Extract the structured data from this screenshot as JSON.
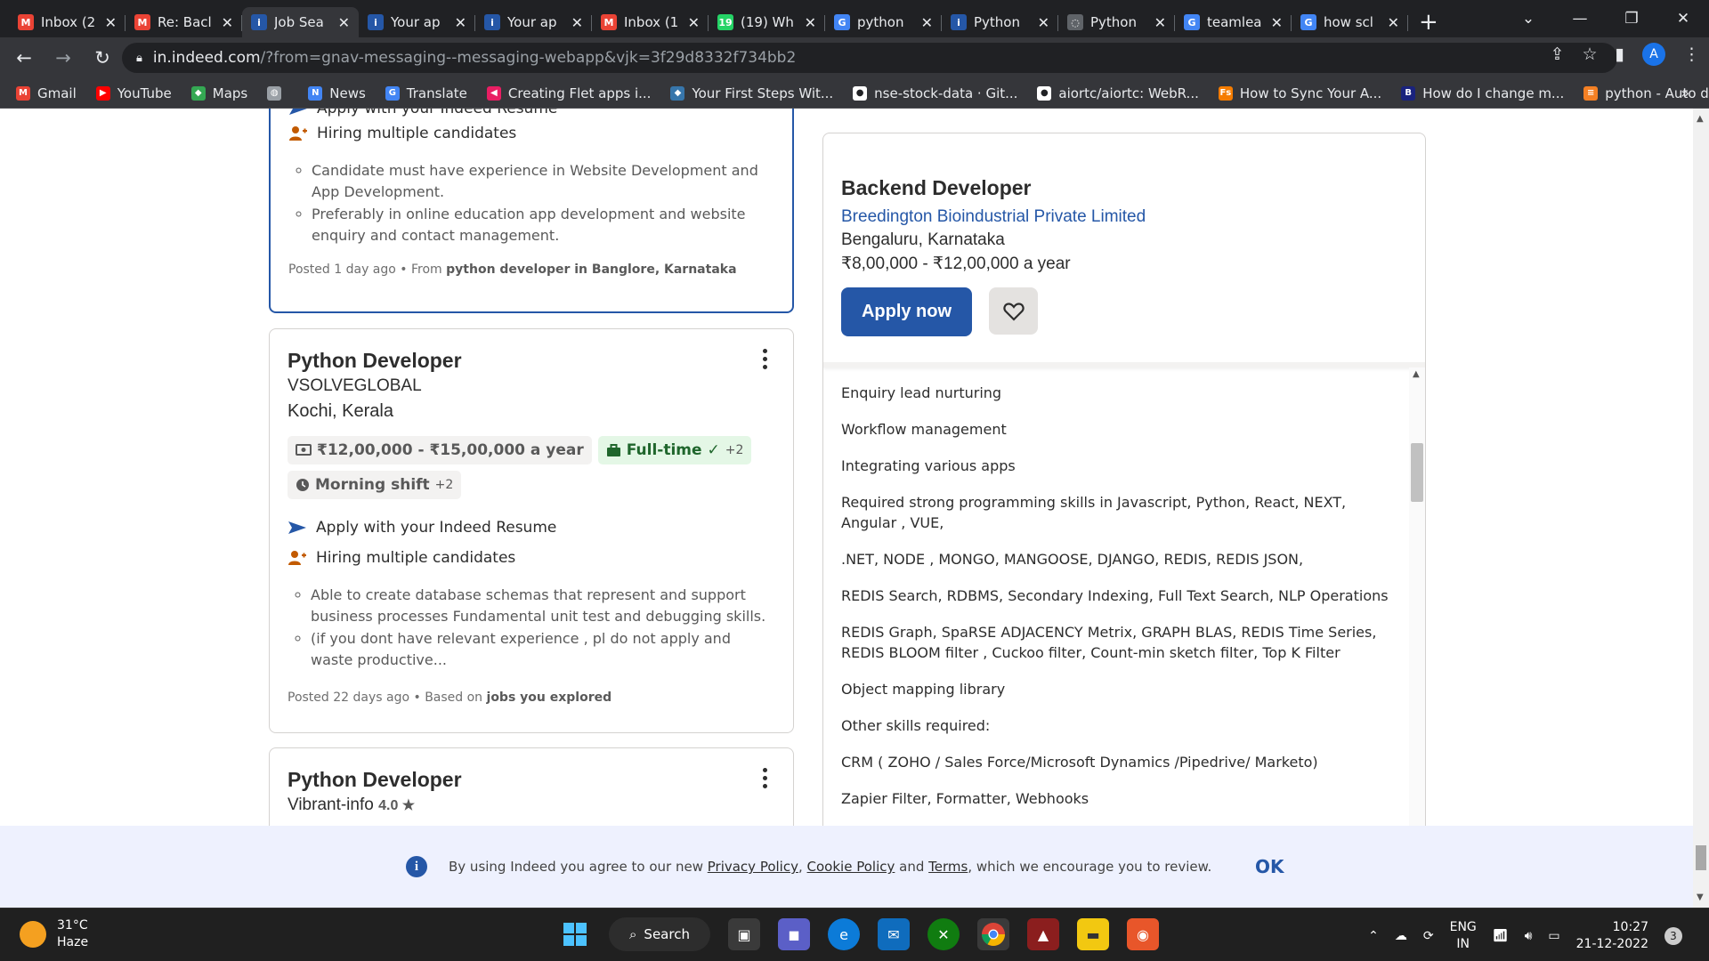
{
  "browser": {
    "tabs": [
      {
        "label": "Inbox (2",
        "icon": "gmail-icon",
        "color": "#ea4335",
        "glyph": "M"
      },
      {
        "label": "Re: Bacl",
        "icon": "gmail-icon",
        "color": "#ea4335",
        "glyph": "M"
      },
      {
        "label": "Job Sea",
        "icon": "indeed-icon",
        "color": "#2557a7",
        "glyph": "i",
        "active": true
      },
      {
        "label": "Your ap",
        "icon": "indeed-icon",
        "color": "#2557a7",
        "glyph": "i"
      },
      {
        "label": "Your ap",
        "icon": "indeed-icon",
        "color": "#2557a7",
        "glyph": "i"
      },
      {
        "label": "Inbox (1",
        "icon": "gmail-icon",
        "color": "#ea4335",
        "glyph": "M"
      },
      {
        "label": "(19) Wh",
        "icon": "whatsapp-icon",
        "color": "#25d366",
        "glyph": "19"
      },
      {
        "label": "python",
        "icon": "google-icon",
        "color": "#4285f4",
        "glyph": "G"
      },
      {
        "label": "Python",
        "icon": "indeed-icon",
        "color": "#2557a7",
        "glyph": "i"
      },
      {
        "label": "Python",
        "icon": "loading-icon",
        "color": "#5f6368",
        "glyph": "◌"
      },
      {
        "label": "teamlea",
        "icon": "google-icon",
        "color": "#4285f4",
        "glyph": "G"
      },
      {
        "label": "how scl",
        "icon": "google-icon",
        "color": "#4285f4",
        "glyph": "G"
      }
    ],
    "url_host": "in.indeed.com",
    "url_path": "/?from=gnav-messaging--messaging-webapp&vjk=3f29d8332f734bb2",
    "profile_initial": "A",
    "bookmarks": [
      {
        "label": "Gmail",
        "color": "#ea4335",
        "glyph": "M"
      },
      {
        "label": "YouTube",
        "color": "#ff0000",
        "glyph": "▶"
      },
      {
        "label": "Maps",
        "color": "#34a853",
        "glyph": "◆"
      },
      {
        "label": "",
        "color": "#9aa0a6",
        "glyph": "◍"
      },
      {
        "label": "News",
        "color": "#4285f4",
        "glyph": "N"
      },
      {
        "label": "Translate",
        "color": "#4285f4",
        "glyph": "G"
      },
      {
        "label": "Creating Flet apps i...",
        "color": "#e91e63",
        "glyph": "◀"
      },
      {
        "label": "Your First Steps Wit...",
        "color": "#3776ab",
        "glyph": "◆"
      },
      {
        "label": "nse-stock-data · Git...",
        "color": "#ffffff",
        "glyph": "●"
      },
      {
        "label": "aiortc/aiortc: WebR...",
        "color": "#ffffff",
        "glyph": "●"
      },
      {
        "label": "How to Sync Your A...",
        "color": "#f57c00",
        "glyph": "Fs"
      },
      {
        "label": "How do I change m...",
        "color": "#1a237e",
        "glyph": "B"
      },
      {
        "label": "python - Auto delet...",
        "color": "#f48024",
        "glyph": "≡"
      }
    ]
  },
  "jobs": [
    {
      "features": [
        {
          "label": "Apply with your Indeed Resume",
          "icon": "arrow-send-icon"
        },
        {
          "label": "Hiring multiple candidates",
          "icon": "people-icon"
        }
      ],
      "snippets": [
        "Candidate must have experience in Website Development and App Development.",
        "Preferably in online education app development and website enquiry and contact management."
      ],
      "posted": "Posted 1 day ago • From ",
      "posted_bold": "python developer in Banglore, Karnataka"
    },
    {
      "title": "Python Developer",
      "company": "VSOLVEGLOBAL",
      "location": "Kochi, Kerala",
      "salary": "₹12,00,000 - ₹15,00,000 a year",
      "jobtype": "Full-time",
      "jobtype_more": "+2",
      "shift": "Morning shift",
      "shift_more": "+2",
      "features": [
        {
          "label": "Apply with your Indeed Resume",
          "icon": "arrow-send-icon"
        },
        {
          "label": "Hiring multiple candidates",
          "icon": "people-icon"
        }
      ],
      "snippets": [
        "Able to create database schemas that represent and support business processes Fundamental unit test and debugging skills.",
        "(if you dont have relevant experience , pl do not apply and waste productive..."
      ],
      "posted": "Posted 22 days ago • Based on ",
      "posted_bold": "jobs you explored"
    },
    {
      "title": "Python Developer",
      "company": "Vibrant-info",
      "rating": "4.0 ★"
    }
  ],
  "detail": {
    "title": "Backend Developer",
    "company": "Breedington Bioindustrial Private Limited",
    "location": "Bengaluru, Karnataka",
    "salary": "₹8,00,000 - ₹12,00,000 a year",
    "apply_label": "Apply now",
    "body": [
      "Enquiry lead nurturing",
      "Workflow management",
      "Integrating various apps",
      "Required strong programming skills in Javascript, Python, React, NEXT, Angular , VUE,",
      ".NET, NODE , MONGO, MANGOOSE, DJANGO, REDIS, REDIS JSON,",
      "REDIS Search, RDBMS, Secondary Indexing, Full Text Search, NLP Operations",
      "REDIS Graph, SpaRSE ADJACENCY Metrix, GRAPH BLAS, REDIS Time Series, REDIS BLOOM filter , Cuckoo filter, Count-min sketch filter, Top K Filter",
      "Object mapping library",
      "Other skills required:",
      "CRM ( ZOHO / Sales Force/Microsoft Dynamics /Pipedrive/ Marketo)",
      "Zapier Filter, Formatter, Webhooks"
    ]
  },
  "cookie": {
    "text1": "By using Indeed you agree to our new ",
    "privacy": "Privacy Policy",
    "sep": ", ",
    "cookie_policy": "Cookie Policy",
    "and": " and ",
    "terms": "Terms",
    "text2": ", which we encourage you to review.",
    "ok": "OK"
  },
  "taskbar": {
    "temp": "31°C",
    "weather": "Haze",
    "search": "Search",
    "lang1": "ENG",
    "lang2": "IN",
    "time": "10:27",
    "date": "21-12-2022",
    "notifications": "3"
  }
}
